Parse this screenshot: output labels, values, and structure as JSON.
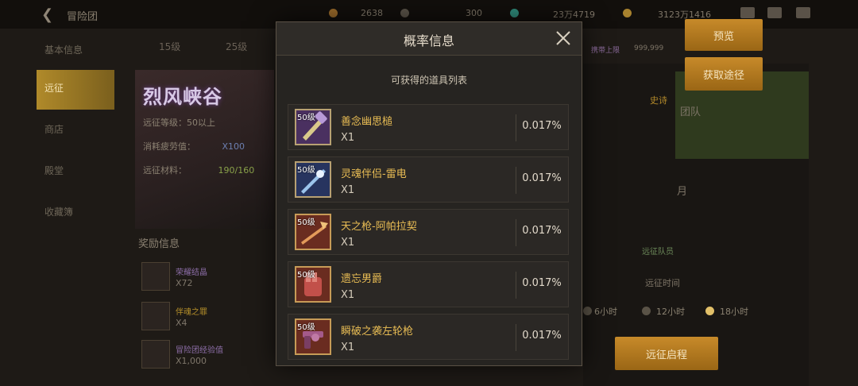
{
  "background": {
    "title": "冒险团",
    "resources": [
      "2638",
      "300",
      "23万4719",
      "3123万1416"
    ],
    "side_nav": [
      "基本信息",
      "远征",
      "商店",
      "殿堂",
      "收藏簿"
    ],
    "stage_tabs": [
      "15级",
      "25级"
    ],
    "dungeon": {
      "name": "烈风峡谷",
      "level_label": "远征等级：50以上",
      "fatigue_label": "消耗疲劳值：",
      "fatigue_value": "X100",
      "material_label": "远征材料：",
      "material_value": "190/160"
    },
    "reward_title": "奖励信息",
    "rewards": [
      {
        "name": "荣耀结晶",
        "count": "X72"
      },
      {
        "name": "伴魂之罪",
        "count": "X4"
      },
      {
        "name": "冒险团经验值",
        "count": "X1,000"
      }
    ],
    "right": {
      "preview_btn": "预览",
      "obtain_btn": "获取途径",
      "limit_label": "携带上限",
      "limit_value": "999,999",
      "epic_label": "史诗",
      "team_label": "团队",
      "month_label": "月",
      "dispatch_label": "远征队员",
      "time_title": "远征时间",
      "time_options": [
        "6小时",
        "12小时",
        "18小时"
      ],
      "start_btn": "远征启程"
    }
  },
  "modal": {
    "title": "概率信息",
    "subtitle": "可获得的道具列表",
    "items": [
      {
        "level": "50级",
        "name": "善念幽思槌",
        "qty": "X1",
        "rate": "0.017%",
        "icon": "hammer-icon"
      },
      {
        "level": "50级",
        "name": "灵魂伴侣-雷电",
        "qty": "X1",
        "rate": "0.017%",
        "icon": "lance-icon"
      },
      {
        "level": "50级",
        "name": "天之枪-阿帕拉契",
        "qty": "X1",
        "rate": "0.017%",
        "icon": "spear-icon"
      },
      {
        "level": "50级",
        "name": "遗忘男爵",
        "qty": "X1",
        "rate": "0.017%",
        "icon": "gauntlet-icon"
      },
      {
        "level": "50级",
        "name": "瞬破之袭左轮枪",
        "qty": "X1",
        "rate": "0.017%",
        "icon": "revolver-icon"
      }
    ]
  }
}
